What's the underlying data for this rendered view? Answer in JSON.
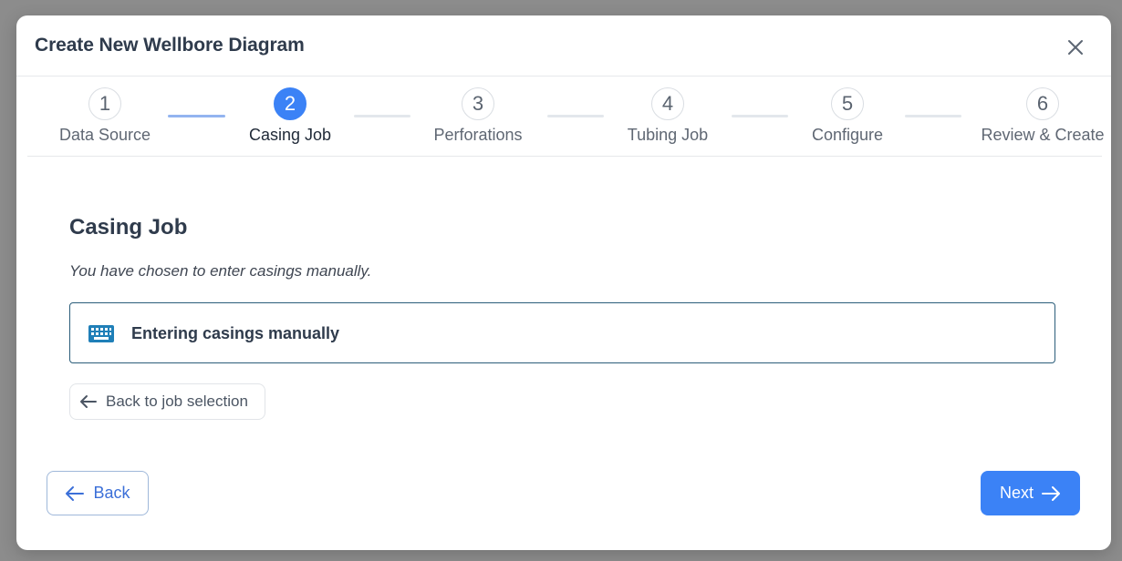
{
  "dialog": {
    "title": "Create New Wellbore Diagram",
    "close_icon": "close-icon"
  },
  "stepper": {
    "current_step": 2,
    "steps": [
      {
        "number": "1",
        "label": "Data Source"
      },
      {
        "number": "2",
        "label": "Casing Job"
      },
      {
        "number": "3",
        "label": "Perforations"
      },
      {
        "number": "4",
        "label": "Tubing Job"
      },
      {
        "number": "5",
        "label": "Configure"
      },
      {
        "number": "6",
        "label": "Review & Create"
      }
    ]
  },
  "content": {
    "title": "Casing Job",
    "subtitle": "You have chosen to enter casings manually.",
    "selection": {
      "icon": "keyboard-icon",
      "label": "Entering casings manually"
    },
    "back_to_selection_label": "Back to job selection"
  },
  "footer": {
    "back_label": "Back",
    "next_label": "Next"
  },
  "colors": {
    "primary": "#3b82f6",
    "keyboard_icon": "#1f7fb8",
    "selection_border": "#2b5d7a"
  }
}
